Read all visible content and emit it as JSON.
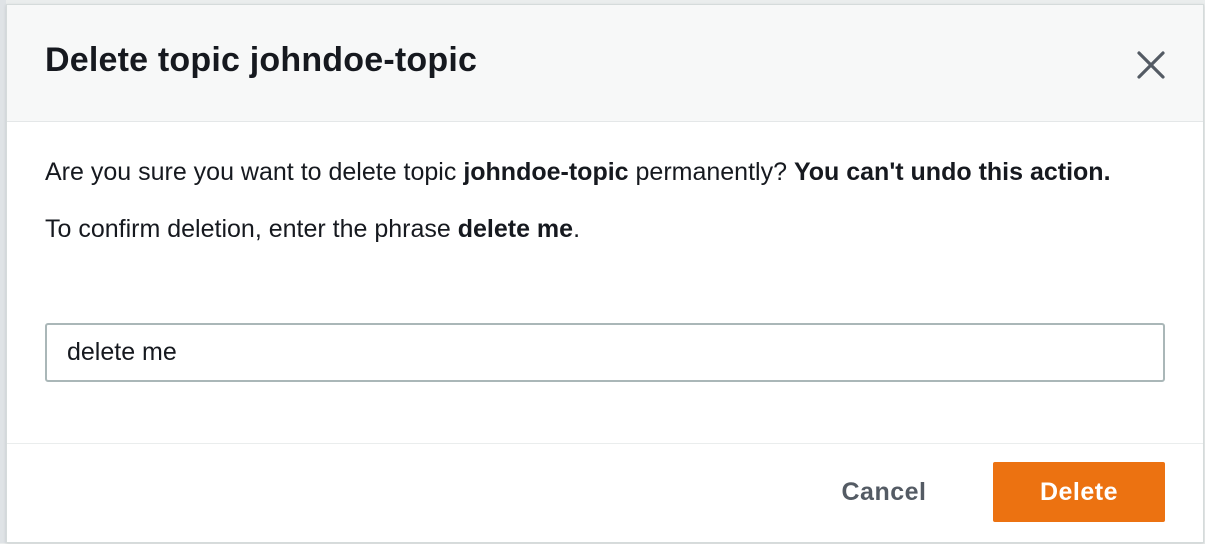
{
  "dialog": {
    "title": "Delete topic johndoe-topic",
    "close_icon": "close-icon"
  },
  "body": {
    "warning_prefix": "Are you sure you want to delete topic ",
    "topic_name": "johndoe-topic",
    "warning_middle": " permanently? ",
    "warning_emphasis": "You can't undo this action.",
    "confirm_prefix": "To confirm deletion, enter the phrase ",
    "confirm_phrase": "delete me",
    "confirm_suffix": "."
  },
  "input": {
    "value": "delete me"
  },
  "footer": {
    "cancel_label": "Cancel",
    "delete_label": "Delete"
  },
  "colors": {
    "primary_button": "#ec7211",
    "header_background": "#f7f8f8"
  }
}
